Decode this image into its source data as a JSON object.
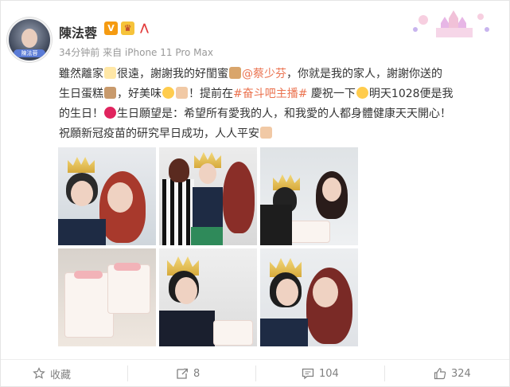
{
  "user": {
    "name": "陳法蓉",
    "avatar_label": "陳法蓉"
  },
  "meta": {
    "time": "34分钟前",
    "source": "来自 iPhone 11 Pro Max"
  },
  "post": {
    "p1": "雖然離家",
    "p2": "很遠，謝謝我的好閨蜜",
    "mention": "@蔡少芬",
    "p3": "，你就是我的家人，謝謝你送的",
    "p4": "生日蛋糕",
    "p5": "，好美味",
    "p6": "！提前在",
    "topic": "#奋斗吧主播#",
    "p7": " 慶祝一下",
    "p8": "明天1028便是我",
    "p9": "的生日！",
    "p10": "生日願望是：希望所有愛我的人，和我愛的人都身體健康天天開心！",
    "p11": "祝願新冠疫苗的研究早日成功，人人平安"
  },
  "actions": {
    "favorite": "收藏",
    "repost": "8",
    "comment": "104",
    "like": "324"
  },
  "icons": [
    "star-icon",
    "share-icon",
    "comment-icon",
    "thumbs-up-icon"
  ],
  "colors": {
    "link": "#eb7350",
    "muted": "#808080"
  }
}
